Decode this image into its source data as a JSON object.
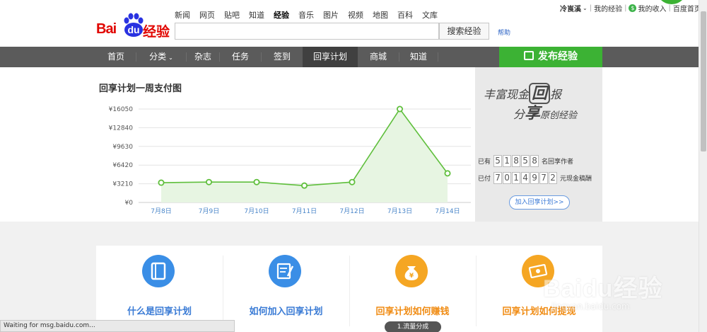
{
  "logo": {
    "bai": "Bai",
    "du": "du",
    "jy": "经验"
  },
  "topnav": [
    "新闻",
    "网页",
    "贴吧",
    "知道",
    "经验",
    "音乐",
    "图片",
    "视频",
    "地图",
    "百科",
    "文库"
  ],
  "topnav_active": "经验",
  "search": {
    "value": "",
    "button": "搜索经验",
    "help": "帮助"
  },
  "user": {
    "name": "冷崀溪",
    "my_exp": "我的经验",
    "my_income": "我的收入",
    "home": "百度首页"
  },
  "nav": {
    "items": [
      "首页",
      "分类",
      "杂志",
      "任务",
      "签到",
      "回享计划",
      "商城",
      "知道"
    ],
    "active": "回享计划",
    "publish": "发布经验"
  },
  "chart_title": "回享计划一周支付图",
  "chart_data": {
    "type": "area",
    "title": "回享计划一周支付图",
    "categories": [
      "7月8日",
      "7月9日",
      "7月10日",
      "7月11日",
      "7月12日",
      "7月13日",
      "7月14日"
    ],
    "values": [
      3400,
      3500,
      3500,
      2900,
      3500,
      16050,
      5000
    ],
    "yticks": [
      "¥16050",
      "¥12840",
      "¥9630",
      "¥6420",
      "¥3210",
      "¥0"
    ],
    "ylim": [
      0,
      16050
    ],
    "grid": true,
    "line_color": "#5fbf3c",
    "fill_color": "#e7f5e2"
  },
  "promo": {
    "line1": "丰富现金",
    "big": "回",
    "line1b": "报",
    "line2a": "分",
    "line2b": "享",
    "line2c": "原创经验",
    "authors_prefix": "已有",
    "authors_digits": [
      "5",
      "1",
      "8",
      "5",
      "8"
    ],
    "authors_suffix": "名回享作者",
    "paid_prefix": "已付",
    "paid_digits": [
      "7",
      "0",
      "1",
      "4",
      "9",
      "7",
      "2"
    ],
    "paid_suffix": "元现金稿酬",
    "join": "加入回享计划>>"
  },
  "cards": [
    {
      "label": "什么是回享计划",
      "color": "#3a8ee6",
      "label_color": "#3a7bd5",
      "icon": "book-icon"
    },
    {
      "label": "如何加入回享计划",
      "color": "#3a8ee6",
      "label_color": "#3a7bd5",
      "icon": "form-icon"
    },
    {
      "label": "回享计划如何赚钱",
      "color": "#f5a623",
      "label_color": "#f08c14",
      "icon": "money-bag-icon"
    },
    {
      "label": "回享计划如何提现",
      "color": "#f5a623",
      "label_color": "#f08c14",
      "icon": "cash-icon"
    }
  ],
  "pill": "1.流量分成",
  "status": "Waiting for msg.baidu.com...",
  "watermark": {
    "text": "Baidu经验",
    "url": "jingyan.baidu.com"
  }
}
